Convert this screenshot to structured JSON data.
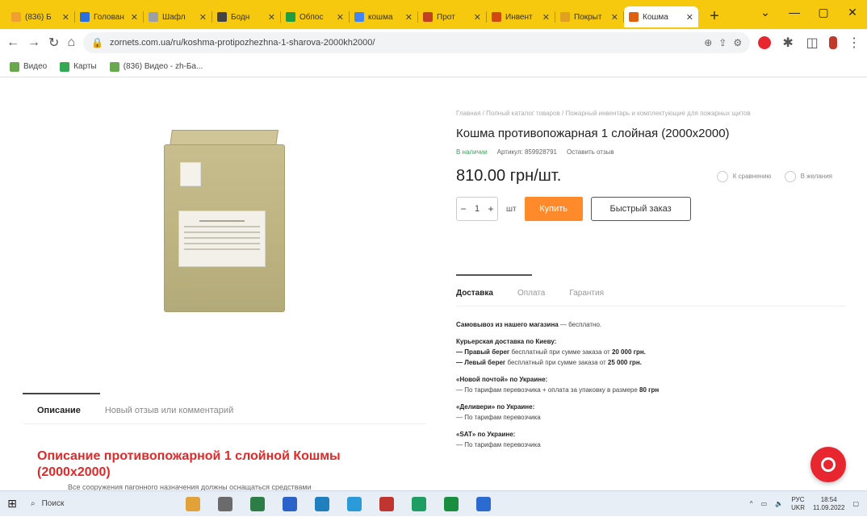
{
  "browser": {
    "tabs": [
      {
        "label": "(836) Б",
        "favicon_color": "#f0a030"
      },
      {
        "label": "Голован",
        "favicon_color": "#2a6fdb"
      },
      {
        "label": "Шафл",
        "favicon_color": "#9aa0a6"
      },
      {
        "label": "Бодн",
        "favicon_color": "#444444"
      },
      {
        "label": "Обпос",
        "favicon_color": "#1e9e40"
      },
      {
        "label": "кошма",
        "favicon_color": "#4285f4"
      },
      {
        "label": "Прот",
        "favicon_color": "#c04020"
      },
      {
        "label": "Инвент",
        "favicon_color": "#d04a10"
      },
      {
        "label": "Покрыт",
        "favicon_color": "#e0a020"
      }
    ],
    "active_tab": {
      "label": "Кошма",
      "favicon_color": "#e06010"
    },
    "new_tab_label": "+",
    "url": "zornets.com.ua/ru/koshma-protipozhezhna-1-sharova-2000kh2000/",
    "bookmarks": [
      {
        "label": "Видео",
        "favicon_color": "#6aa84f"
      },
      {
        "label": "Карты",
        "favicon_color": "#34a853"
      },
      {
        "label": "(836) Видео - zh-Ба...",
        "favicon_color": "#6aa84f"
      }
    ]
  },
  "product": {
    "breadcrumb": "Главная  /  Полный каталог товаров  /  Пожарный инвентарь и комплектующие для пожарных щитов",
    "title": "Кошма противопожарная 1 слойная (2000x2000)",
    "stock": "В наличии",
    "sku": "Артикул: 859928791",
    "review_link": "Оставить отзыв",
    "price": "810.00 грн/шт.",
    "compare_label": "К сравнению",
    "wishlist_label": "В желания",
    "quantity": "1",
    "unit": "шт",
    "minus": "−",
    "plus": "+",
    "buy_label": "Купить",
    "quick_order_label": "Быстрый заказ"
  },
  "description": {
    "tabs": [
      "Описание",
      "Новый отзыв или комментарий"
    ],
    "title": "Описание противопожарной 1 слойной Кошмы (2000x2000)",
    "text": "Все сооружения пагонного назначения должны оснащаться средствами"
  },
  "delivery": {
    "tabs": [
      "Доставка",
      "Оплата",
      "Гарантия"
    ],
    "pickup_bold": "Самовывоз из нашего магазина",
    "pickup_text": " — бесплатно.",
    "courier_title": "Курьерская доставка по Киеву:",
    "right_bank_bold": "— Правый берег",
    "right_bank_text": " бесплатный при сумме заказа от ",
    "right_bank_amount": "20 000 грн.",
    "left_bank_bold": "— Левый берег",
    "left_bank_text": " бесплатный при сумме заказа от ",
    "left_bank_amount": "25 000 грн.",
    "np_title": "«Новой почтой» по Украине:",
    "np_text": "— По тарифам перевозчика + оплата за упаковку в размере ",
    "np_amount": "80 грн",
    "delivery_title": "«Деливери» по Украине:",
    "delivery_text": "— По тарифам перевозчика",
    "sat_title": "«SAT» по Украине:",
    "sat_text": "— По тарифам перевозчика"
  },
  "taskbar": {
    "search_placeholder": "Поиск",
    "lang": "РУС",
    "lang2": "UKR",
    "time": "18:54",
    "date": "11.09.2022",
    "apps": [
      "#e2a23a",
      "#6b6b6b",
      "#2d7d46",
      "#2a62c9",
      "#1f7fbf",
      "#2a9bd8",
      "#c03530",
      "#1e9e62",
      "#1a8e3f",
      "#2b6bd1"
    ]
  }
}
